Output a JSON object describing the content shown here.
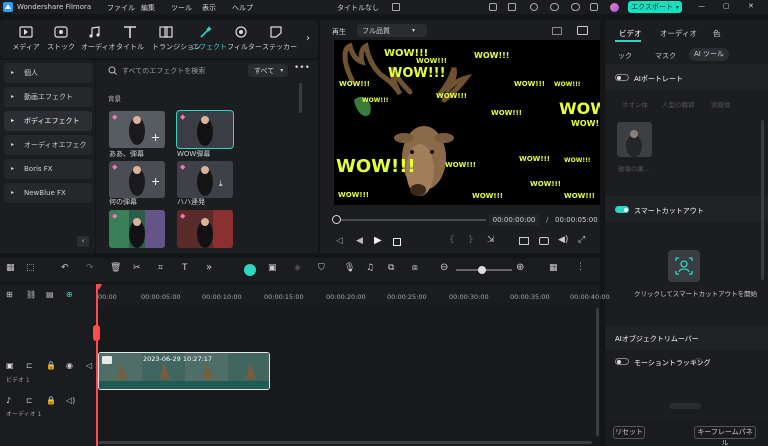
{
  "app": {
    "title": "Wondershare Filmora",
    "doc_title": "タイトルなし",
    "export_label": "エクスポート"
  },
  "menu": [
    "ファイル",
    "編集",
    "ツール",
    "表示",
    "ヘルプ"
  ],
  "toolbar": [
    "メディア",
    "ストック",
    "オーディオ",
    "タイトル",
    "トランジション",
    "エフェクト",
    "フィルター",
    "ステッカー"
  ],
  "sidebar": [
    "個人",
    "動画エフェクト",
    "ボディエフェクト",
    "オーディオエフェクト",
    "Boris FX",
    "NewBlue FX"
  ],
  "search": {
    "placeholder": "すべてのエフェクトを検索",
    "filter": "すべて"
  },
  "section_label": "背景",
  "effects": [
    {
      "name": "ああ、弾幕"
    },
    {
      "name": "WOW弾幕"
    },
    {
      "name": "何の弾幕"
    },
    {
      "name": "ハハ連発"
    }
  ],
  "player": {
    "label": "再生",
    "quality": "フル品質",
    "current_time": "00:00:00:00",
    "separator": "/",
    "total_time": "00:00:05:00"
  },
  "right_panel": {
    "tabs": [
      "ビデオ",
      "オーディオ",
      "色"
    ],
    "subtabs": [
      "ック",
      "マスク",
      "AI ツール"
    ],
    "portrait_label": "AIポートレート",
    "portrait_options": [
      "ネオン体",
      "人型の輪郭",
      "実線体"
    ],
    "portrait_caption": "破壊の果...",
    "smart_cutout_label": "スマートカットアウト",
    "smart_cutout_hint": "クリックしてスマートカットアウトを開始",
    "remover_label": "AIオブジェクトリムーバー",
    "motion_tracking": "モーショントラッキング",
    "reset": "リセット",
    "keyframe": "キーフレームパネル"
  },
  "timeline": {
    "ticks": [
      "00:00",
      "00:00:05:00",
      "00:00:10:00",
      "00:00:15:00",
      "00:00:20:00",
      "00:00:25:00",
      "00:00:30:00",
      "00:00:35:00",
      "00:00:40:00"
    ],
    "video_track_label": "ビデオ 1",
    "audio_track_label": "オーディオ 1",
    "clip_label": "2023-06-29 10:27:17"
  },
  "overlay_text": "WOW!!!",
  "colors": {
    "accent": "#2fd6c3",
    "export_bg": "#15e0c2",
    "wow": "#e6ff3a",
    "playhead": "#ff4b4b"
  }
}
